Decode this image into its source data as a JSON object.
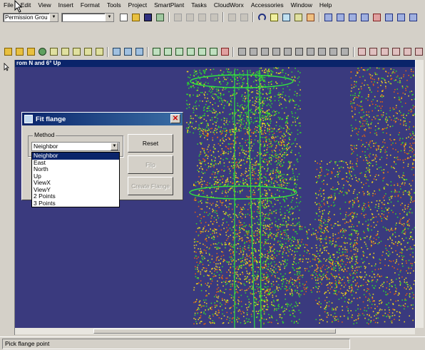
{
  "menu": [
    "File",
    "Edit",
    "View",
    "Insert",
    "Format",
    "Tools",
    "Project",
    "SmartPlant",
    "Tasks",
    "CloudWorx",
    "Accessories",
    "Window",
    "Help"
  ],
  "toolbar": {
    "permission_group": "Permission Grou",
    "second_combo": ""
  },
  "viewport": {
    "title": "rom N and 6° Up",
    "background": "#3a3a7e"
  },
  "dialog": {
    "title": "Fit flange",
    "method_label": "Method",
    "method_value": "Neighbor",
    "options": [
      "Neighbor",
      "East",
      "North",
      "Up",
      "ViewX",
      "ViewY",
      "2 Points",
      "3 Points"
    ],
    "selected_index": 0,
    "reset_label": "Reset",
    "flip_label": "Flip",
    "create_label": "Create Flange"
  },
  "status": {
    "text": "Pick flange point"
  },
  "colors": {
    "title_bar": "#0a246a",
    "points_green": "#2fd02f",
    "points_yellow": "#e8d020",
    "points_orange": "#e06010"
  }
}
